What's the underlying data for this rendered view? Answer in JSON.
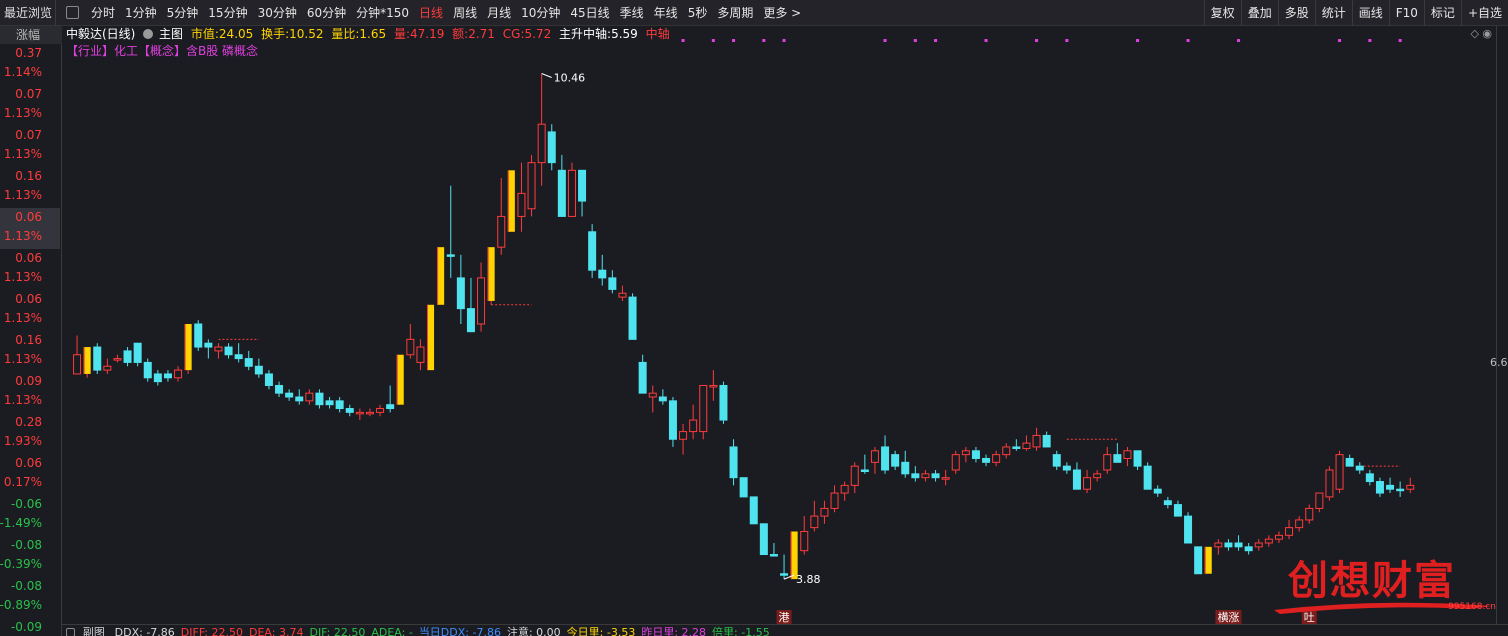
{
  "toolbar": {
    "recent_label": "最近浏览",
    "periods": [
      "分时",
      "1分钟",
      "5分钟",
      "15分钟",
      "30分钟",
      "60分钟",
      "分钟*150",
      "日线",
      "周线",
      "月线",
      "10分钟",
      "45日线",
      "季线",
      "年线",
      "5秒",
      "多周期",
      "更多 >"
    ],
    "active_period": "日线",
    "tools": [
      "复权",
      "叠加",
      "多股",
      "统计",
      "画线",
      "F10",
      "标记",
      "+自选"
    ]
  },
  "left_column": {
    "header": "涨幅",
    "rows": [
      {
        "v1": "0.37",
        "v2": "1.14%",
        "dir": "up"
      },
      {
        "v1": "0.07",
        "v2": "1.13%",
        "dir": "up"
      },
      {
        "v1": "0.07",
        "v2": "1.13%",
        "dir": "up"
      },
      {
        "v1": "0.16",
        "v2": "1.13%",
        "dir": "up"
      },
      {
        "v1": "0.06",
        "v2": "1.13%",
        "dir": "up"
      },
      {
        "v1": "0.06",
        "v2": "1.13%",
        "dir": "up"
      },
      {
        "v1": "0.06",
        "v2": "1.13%",
        "dir": "up"
      },
      {
        "v1": "0.16",
        "v2": "1.13%",
        "dir": "up"
      },
      {
        "v1": "0.09",
        "v2": "1.13%",
        "dir": "up"
      },
      {
        "v1": "0.28",
        "v2": "1.93%",
        "dir": "up"
      },
      {
        "v1": "0.06",
        "v2": "0.17%",
        "dir": "up"
      },
      {
        "v1": "-0.06",
        "v2": "-1.49%",
        "dir": "dn"
      },
      {
        "v1": "-0.08",
        "v2": "-0.39%",
        "dir": "dn"
      },
      {
        "v1": "-0.08",
        "v2": "-0.89%",
        "dir": "dn"
      },
      {
        "v1": "-0.09",
        "v2": "",
        "dir": "dn"
      }
    ],
    "selected_row": 4
  },
  "info": {
    "stock": "中毅达(日线)",
    "main_chart": "主图",
    "market_cap_label": "市值:",
    "market_cap": "24.05",
    "turnover_label": "换手:",
    "turnover": "10.52",
    "volume_ratio_label": "量比:",
    "volume_ratio": "1.65",
    "vol_label": "量:",
    "vol": "47.19",
    "amount_label": "额:",
    "amount": "2.71",
    "cg_label": "CG:",
    "cg": "5.72",
    "axis_label": "主升中轴:",
    "axis_value": "5.59",
    "axis_tag": "中轴",
    "industry_line": "【行业】化工【概念】含B股 磷概念",
    "ctrl_icons": "◇ ◉",
    "colors": {
      "label": "#ffd400",
      "value": "#ffffff",
      "red": "#ff3b3b",
      "magenta": "#e040e0"
    }
  },
  "chart_data": {
    "type": "candlestick",
    "title": "中毅达(日线)",
    "xlabel": "",
    "ylabel": "",
    "ylim": [
      3.4,
      11.0
    ],
    "grid": false,
    "up_color": "#ff3b3b",
    "down_color": "#4fe3ef",
    "limit_up_color": "#ffd400",
    "candles": [
      {
        "o": 6.55,
        "h": 7.05,
        "l": 6.55,
        "c": 6.8,
        "k": "u"
      },
      {
        "o": 6.55,
        "h": 6.9,
        "l": 6.5,
        "c": 6.9,
        "k": "lu"
      },
      {
        "o": 6.9,
        "h": 6.95,
        "l": 6.55,
        "c": 6.6,
        "k": "d"
      },
      {
        "o": 6.6,
        "h": 6.75,
        "l": 6.55,
        "c": 6.65,
        "k": "u"
      },
      {
        "o": 6.75,
        "h": 6.8,
        "l": 6.7,
        "c": 6.75,
        "k": "u"
      },
      {
        "o": 6.85,
        "h": 6.9,
        "l": 6.65,
        "c": 6.7,
        "k": "d"
      },
      {
        "o": 6.95,
        "h": 6.95,
        "l": 6.65,
        "c": 6.7,
        "k": "d"
      },
      {
        "o": 6.7,
        "h": 6.75,
        "l": 6.45,
        "c": 6.5,
        "k": "d"
      },
      {
        "o": 6.55,
        "h": 6.6,
        "l": 6.4,
        "c": 6.45,
        "k": "d"
      },
      {
        "o": 6.55,
        "h": 6.6,
        "l": 6.45,
        "c": 6.5,
        "k": "d"
      },
      {
        "o": 6.5,
        "h": 6.65,
        "l": 6.45,
        "c": 6.6,
        "k": "u"
      },
      {
        "o": 6.6,
        "h": 7.2,
        "l": 6.55,
        "c": 7.2,
        "k": "lu"
      },
      {
        "o": 7.2,
        "h": 7.25,
        "l": 6.85,
        "c": 6.9,
        "k": "d"
      },
      {
        "o": 6.9,
        "h": 7.0,
        "l": 6.75,
        "c": 6.95,
        "k": "d"
      },
      {
        "o": 6.85,
        "h": 6.95,
        "l": 6.75,
        "c": 6.9,
        "k": "u"
      },
      {
        "o": 6.9,
        "h": 6.95,
        "l": 6.75,
        "c": 6.8,
        "k": "d"
      },
      {
        "o": 6.8,
        "h": 6.95,
        "l": 6.7,
        "c": 6.75,
        "k": "d"
      },
      {
        "o": 6.75,
        "h": 6.85,
        "l": 6.6,
        "c": 6.65,
        "k": "d"
      },
      {
        "o": 6.65,
        "h": 6.75,
        "l": 6.5,
        "c": 6.55,
        "k": "d"
      },
      {
        "o": 6.55,
        "h": 6.6,
        "l": 6.35,
        "c": 6.4,
        "k": "d"
      },
      {
        "o": 6.4,
        "h": 6.45,
        "l": 6.25,
        "c": 6.3,
        "k": "d"
      },
      {
        "o": 6.3,
        "h": 6.35,
        "l": 6.2,
        "c": 6.25,
        "k": "d"
      },
      {
        "o": 6.25,
        "h": 6.35,
        "l": 6.15,
        "c": 6.2,
        "k": "d"
      },
      {
        "o": 6.2,
        "h": 6.35,
        "l": 6.15,
        "c": 6.3,
        "k": "u"
      },
      {
        "o": 6.3,
        "h": 6.35,
        "l": 6.1,
        "c": 6.15,
        "k": "d"
      },
      {
        "o": 6.15,
        "h": 6.25,
        "l": 6.1,
        "c": 6.2,
        "k": "d"
      },
      {
        "o": 6.2,
        "h": 6.25,
        "l": 6.05,
        "c": 6.1,
        "k": "d"
      },
      {
        "o": 6.1,
        "h": 6.15,
        "l": 6.0,
        "c": 6.05,
        "k": "d"
      },
      {
        "o": 6.05,
        "h": 6.1,
        "l": 5.95,
        "c": 6.05,
        "k": "u"
      },
      {
        "o": 6.05,
        "h": 6.1,
        "l": 6.0,
        "c": 6.05,
        "k": "u"
      },
      {
        "o": 6.05,
        "h": 6.15,
        "l": 6.0,
        "c": 6.1,
        "k": "u"
      },
      {
        "o": 6.1,
        "h": 6.4,
        "l": 6.05,
        "c": 6.15,
        "k": "d"
      },
      {
        "o": 6.15,
        "h": 6.8,
        "l": 6.15,
        "c": 6.8,
        "k": "lu"
      },
      {
        "o": 6.8,
        "h": 7.2,
        "l": 6.75,
        "c": 7.0,
        "k": "u"
      },
      {
        "o": 6.7,
        "h": 7.0,
        "l": 6.6,
        "c": 6.9,
        "k": "u"
      },
      {
        "o": 6.6,
        "h": 7.45,
        "l": 6.6,
        "c": 7.45,
        "k": "lu"
      },
      {
        "o": 7.45,
        "h": 8.2,
        "l": 7.45,
        "c": 8.2,
        "k": "lu"
      },
      {
        "o": 8.1,
        "h": 9.0,
        "l": 7.8,
        "c": 8.1,
        "k": "d"
      },
      {
        "o": 7.8,
        "h": 8.1,
        "l": 7.2,
        "c": 7.4,
        "k": "d"
      },
      {
        "o": 7.4,
        "h": 7.8,
        "l": 7.1,
        "c": 7.1,
        "k": "d"
      },
      {
        "o": 7.2,
        "h": 8.0,
        "l": 7.1,
        "c": 7.8,
        "k": "u"
      },
      {
        "o": 7.5,
        "h": 8.2,
        "l": 7.45,
        "c": 8.2,
        "k": "lu"
      },
      {
        "o": 8.2,
        "h": 9.1,
        "l": 8.1,
        "c": 8.6,
        "k": "u"
      },
      {
        "o": 8.4,
        "h": 9.2,
        "l": 8.4,
        "c": 9.2,
        "k": "lu"
      },
      {
        "o": 8.6,
        "h": 9.3,
        "l": 8.4,
        "c": 8.9,
        "k": "u"
      },
      {
        "o": 8.7,
        "h": 9.4,
        "l": 8.6,
        "c": 9.3,
        "k": "u"
      },
      {
        "o": 9.3,
        "h": 10.46,
        "l": 9.0,
        "c": 9.8,
        "k": "u"
      },
      {
        "o": 9.7,
        "h": 9.8,
        "l": 9.2,
        "c": 9.3,
        "k": "d"
      },
      {
        "o": 9.2,
        "h": 9.4,
        "l": 8.6,
        "c": 8.6,
        "k": "d"
      },
      {
        "o": 8.6,
        "h": 9.3,
        "l": 8.6,
        "c": 9.2,
        "k": "u"
      },
      {
        "o": 9.2,
        "h": 9.2,
        "l": 8.6,
        "c": 8.8,
        "k": "d"
      },
      {
        "o": 8.4,
        "h": 8.5,
        "l": 7.8,
        "c": 7.9,
        "k": "d"
      },
      {
        "o": 7.9,
        "h": 8.1,
        "l": 7.7,
        "c": 7.8,
        "k": "d"
      },
      {
        "o": 7.8,
        "h": 7.9,
        "l": 7.6,
        "c": 7.65,
        "k": "d"
      },
      {
        "o": 7.6,
        "h": 7.7,
        "l": 7.5,
        "c": 7.55,
        "k": "u"
      },
      {
        "o": 7.55,
        "h": 7.6,
        "l": 7.0,
        "c": 7.0,
        "k": "d"
      },
      {
        "o": 6.7,
        "h": 6.8,
        "l": 6.3,
        "c": 6.3,
        "k": "d"
      },
      {
        "o": 6.3,
        "h": 6.4,
        "l": 6.05,
        "c": 6.25,
        "k": "u"
      },
      {
        "o": 6.25,
        "h": 6.35,
        "l": 6.15,
        "c": 6.2,
        "k": "d"
      },
      {
        "o": 6.2,
        "h": 6.25,
        "l": 5.6,
        "c": 5.7,
        "k": "d"
      },
      {
        "o": 5.7,
        "h": 5.9,
        "l": 5.5,
        "c": 5.8,
        "k": "u"
      },
      {
        "o": 5.8,
        "h": 6.15,
        "l": 5.7,
        "c": 5.95,
        "k": "u"
      },
      {
        "o": 5.8,
        "h": 6.4,
        "l": 5.7,
        "c": 6.4,
        "k": "u"
      },
      {
        "o": 6.4,
        "h": 6.6,
        "l": 6.2,
        "c": 6.4,
        "k": "u"
      },
      {
        "o": 6.4,
        "h": 6.45,
        "l": 5.9,
        "c": 5.95,
        "k": "d"
      },
      {
        "o": 5.6,
        "h": 5.7,
        "l": 5.1,
        "c": 5.2,
        "k": "d"
      },
      {
        "o": 5.2,
        "h": 5.2,
        "l": 4.95,
        "c": 4.95,
        "k": "d"
      },
      {
        "o": 4.95,
        "h": 4.95,
        "l": 4.6,
        "c": 4.6,
        "k": "d"
      },
      {
        "o": 4.6,
        "h": 4.6,
        "l": 4.2,
        "c": 4.2,
        "k": "d"
      },
      {
        "o": 4.2,
        "h": 4.35,
        "l": 4.2,
        "c": 4.2,
        "k": "d"
      },
      {
        "o": 3.95,
        "h": 4.2,
        "l": 3.88,
        "c": 3.95,
        "k": "d"
      },
      {
        "o": 3.88,
        "h": 4.5,
        "l": 3.88,
        "c": 4.5,
        "k": "lu"
      },
      {
        "o": 4.25,
        "h": 4.7,
        "l": 4.2,
        "c": 4.5,
        "k": "u"
      },
      {
        "o": 4.55,
        "h": 4.9,
        "l": 4.5,
        "c": 4.7,
        "k": "u"
      },
      {
        "o": 4.7,
        "h": 4.9,
        "l": 4.6,
        "c": 4.8,
        "k": "u"
      },
      {
        "o": 4.8,
        "h": 5.1,
        "l": 4.75,
        "c": 5.0,
        "k": "u"
      },
      {
        "o": 5.0,
        "h": 5.15,
        "l": 4.9,
        "c": 5.1,
        "k": "u"
      },
      {
        "o": 5.1,
        "h": 5.4,
        "l": 5.0,
        "c": 5.35,
        "k": "u"
      },
      {
        "o": 5.3,
        "h": 5.5,
        "l": 5.25,
        "c": 5.3,
        "k": "d"
      },
      {
        "o": 5.4,
        "h": 5.6,
        "l": 5.25,
        "c": 5.55,
        "k": "u"
      },
      {
        "o": 5.6,
        "h": 5.75,
        "l": 5.25,
        "c": 5.3,
        "k": "d"
      },
      {
        "o": 5.5,
        "h": 5.55,
        "l": 5.3,
        "c": 5.35,
        "k": "d"
      },
      {
        "o": 5.4,
        "h": 5.55,
        "l": 5.2,
        "c": 5.25,
        "k": "d"
      },
      {
        "o": 5.25,
        "h": 5.35,
        "l": 5.15,
        "c": 5.2,
        "k": "d"
      },
      {
        "o": 5.2,
        "h": 5.3,
        "l": 5.15,
        "c": 5.25,
        "k": "u"
      },
      {
        "o": 5.25,
        "h": 5.3,
        "l": 5.15,
        "c": 5.2,
        "k": "d"
      },
      {
        "o": 5.2,
        "h": 5.3,
        "l": 5.1,
        "c": 5.2,
        "k": "u"
      },
      {
        "o": 5.3,
        "h": 5.55,
        "l": 5.25,
        "c": 5.5,
        "k": "u"
      },
      {
        "o": 5.5,
        "h": 5.6,
        "l": 5.4,
        "c": 5.55,
        "k": "u"
      },
      {
        "o": 5.55,
        "h": 5.6,
        "l": 5.4,
        "c": 5.45,
        "k": "d"
      },
      {
        "o": 5.45,
        "h": 5.5,
        "l": 5.35,
        "c": 5.4,
        "k": "d"
      },
      {
        "o": 5.4,
        "h": 5.55,
        "l": 5.35,
        "c": 5.5,
        "k": "u"
      },
      {
        "o": 5.5,
        "h": 5.65,
        "l": 5.45,
        "c": 5.6,
        "k": "u"
      },
      {
        "o": 5.6,
        "h": 5.7,
        "l": 5.55,
        "c": 5.58,
        "k": "d"
      },
      {
        "o": 5.58,
        "h": 5.75,
        "l": 5.55,
        "c": 5.65,
        "k": "u"
      },
      {
        "o": 5.6,
        "h": 5.85,
        "l": 5.55,
        "c": 5.75,
        "k": "u"
      },
      {
        "o": 5.75,
        "h": 5.8,
        "l": 5.6,
        "c": 5.6,
        "k": "d"
      },
      {
        "o": 5.5,
        "h": 5.55,
        "l": 5.3,
        "c": 5.35,
        "k": "d"
      },
      {
        "o": 5.35,
        "h": 5.4,
        "l": 5.25,
        "c": 5.3,
        "k": "d"
      },
      {
        "o": 5.3,
        "h": 5.4,
        "l": 5.05,
        "c": 5.05,
        "k": "d"
      },
      {
        "o": 5.05,
        "h": 5.3,
        "l": 5.0,
        "c": 5.2,
        "k": "u"
      },
      {
        "o": 5.2,
        "h": 5.3,
        "l": 5.15,
        "c": 5.25,
        "k": "u"
      },
      {
        "o": 5.3,
        "h": 5.6,
        "l": 5.25,
        "c": 5.5,
        "k": "u"
      },
      {
        "o": 5.5,
        "h": 5.65,
        "l": 5.4,
        "c": 5.4,
        "k": "d"
      },
      {
        "o": 5.45,
        "h": 5.6,
        "l": 5.35,
        "c": 5.55,
        "k": "u"
      },
      {
        "o": 5.55,
        "h": 5.55,
        "l": 5.3,
        "c": 5.35,
        "k": "d"
      },
      {
        "o": 5.35,
        "h": 5.4,
        "l": 5.05,
        "c": 5.05,
        "k": "d"
      },
      {
        "o": 5.05,
        "h": 5.1,
        "l": 4.95,
        "c": 5.0,
        "k": "d"
      },
      {
        "o": 4.9,
        "h": 4.95,
        "l": 4.8,
        "c": 4.85,
        "k": "d"
      },
      {
        "o": 4.85,
        "h": 4.9,
        "l": 4.7,
        "c": 4.7,
        "k": "d"
      },
      {
        "o": 4.7,
        "h": 4.75,
        "l": 4.35,
        "c": 4.35,
        "k": "d"
      },
      {
        "o": 4.3,
        "h": 4.3,
        "l": 3.95,
        "c": 3.95,
        "k": "d"
      },
      {
        "o": 3.95,
        "h": 4.3,
        "l": 3.95,
        "c": 4.3,
        "k": "lu"
      },
      {
        "o": 4.3,
        "h": 4.4,
        "l": 4.2,
        "c": 4.35,
        "k": "u"
      },
      {
        "o": 4.35,
        "h": 4.4,
        "l": 4.25,
        "c": 4.3,
        "k": "d"
      },
      {
        "o": 4.35,
        "h": 4.45,
        "l": 4.25,
        "c": 4.3,
        "k": "d"
      },
      {
        "o": 4.3,
        "h": 4.35,
        "l": 4.2,
        "c": 4.25,
        "k": "d"
      },
      {
        "o": 4.3,
        "h": 4.4,
        "l": 4.25,
        "c": 4.35,
        "k": "u"
      },
      {
        "o": 4.35,
        "h": 4.45,
        "l": 4.3,
        "c": 4.4,
        "k": "u"
      },
      {
        "o": 4.4,
        "h": 4.5,
        "l": 4.35,
        "c": 4.45,
        "k": "u"
      },
      {
        "o": 4.45,
        "h": 4.65,
        "l": 4.4,
        "c": 4.55,
        "k": "u"
      },
      {
        "o": 4.55,
        "h": 4.7,
        "l": 4.5,
        "c": 4.65,
        "k": "u"
      },
      {
        "o": 4.65,
        "h": 4.85,
        "l": 4.6,
        "c": 4.8,
        "k": "u"
      },
      {
        "o": 4.8,
        "h": 5.0,
        "l": 4.75,
        "c": 5.0,
        "k": "u"
      },
      {
        "o": 4.95,
        "h": 5.35,
        "l": 4.9,
        "c": 5.3,
        "k": "u"
      },
      {
        "o": 5.05,
        "h": 5.55,
        "l": 5.0,
        "c": 5.5,
        "k": "u"
      },
      {
        "o": 5.45,
        "h": 5.5,
        "l": 5.35,
        "c": 5.35,
        "k": "d"
      },
      {
        "o": 5.35,
        "h": 5.4,
        "l": 5.25,
        "c": 5.3,
        "k": "d"
      },
      {
        "o": 5.25,
        "h": 5.3,
        "l": 5.1,
        "c": 5.15,
        "k": "d"
      },
      {
        "o": 5.15,
        "h": 5.2,
        "l": 4.95,
        "c": 5.0,
        "k": "d"
      },
      {
        "o": 5.1,
        "h": 5.2,
        "l": 5.0,
        "c": 5.05,
        "k": "d"
      },
      {
        "o": 5.05,
        "h": 5.15,
        "l": 4.95,
        "c": 5.05,
        "k": "d"
      },
      {
        "o": 5.05,
        "h": 5.2,
        "l": 5.0,
        "c": 5.1,
        "k": "u"
      }
    ],
    "annotations": {
      "high_label": "10.46",
      "high_value": 10.46,
      "high_index": 46,
      "low_label": "3.88",
      "low_value": 3.88,
      "low_index": 70
    },
    "tags": [
      {
        "text": "港",
        "index": 70
      },
      {
        "text": "横涨",
        "index": 114
      },
      {
        "text": "吐",
        "index": 122
      }
    ],
    "dash_levels": [
      {
        "value": 7.0,
        "from": 14,
        "to": 18
      },
      {
        "value": 7.45,
        "from": 41,
        "to": 45
      },
      {
        "value": 5.7,
        "from": 98,
        "to": 103
      },
      {
        "value": 5.35,
        "from": 127,
        "to": 131
      }
    ],
    "top_markers": [
      60,
      63,
      65,
      68,
      70,
      80,
      83,
      85,
      90,
      95,
      98,
      105,
      110,
      115,
      125,
      128,
      131
    ]
  },
  "right_scale": {
    "value": "6.6"
  },
  "subbar": {
    "label": "副图",
    "items": [
      {
        "text": "DDX: -7.86",
        "color": "#d8d8d8"
      },
      {
        "text": "DIFF: 22.50",
        "color": "#ff3b3b"
      },
      {
        "text": "DEA: 3.74",
        "color": "#ff3b3b"
      },
      {
        "text": "DIF: 22.50",
        "color": "#29c14a"
      },
      {
        "text": "ADEA: -",
        "color": "#29c14a"
      },
      {
        "text": "当日DDX: -7.86",
        "color": "#3f8fff"
      },
      {
        "text": "注意: 0.00",
        "color": "#d8d8d8"
      },
      {
        "text": "今日里: -3.53",
        "color": "#ffd400"
      },
      {
        "text": "昨日里: 2.28",
        "color": "#e040e0"
      },
      {
        "text": "倍里: -1.55",
        "color": "#29c14a"
      }
    ]
  },
  "watermark": {
    "text": "创想财富",
    "url": "995168.cn"
  }
}
